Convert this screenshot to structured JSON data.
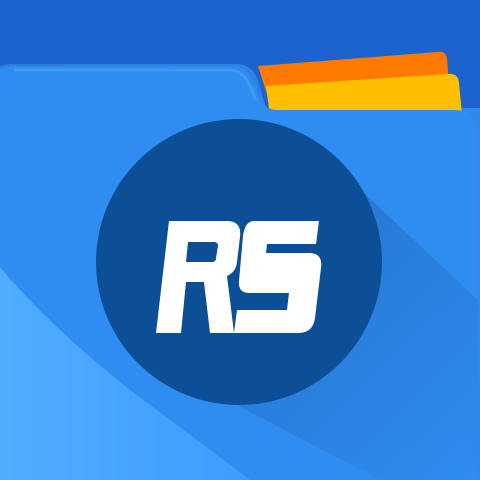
{
  "app_icon": {
    "monogram": "RS",
    "icon_semantic": "folder-icon",
    "colors": {
      "background": "#1d63cf",
      "folder_back": "#2f7fe3",
      "folder_front": "#2f8cf0",
      "folder_front_light": "#46a7ff",
      "folder_front_dark": "#2b7ee8",
      "paper_orange": "#ff7a00",
      "paper_yellow": "#ffbf00",
      "circle": "#0d4f97",
      "circle_shadow": "#0a3f7c",
      "monogram": "#ffffff"
    }
  }
}
